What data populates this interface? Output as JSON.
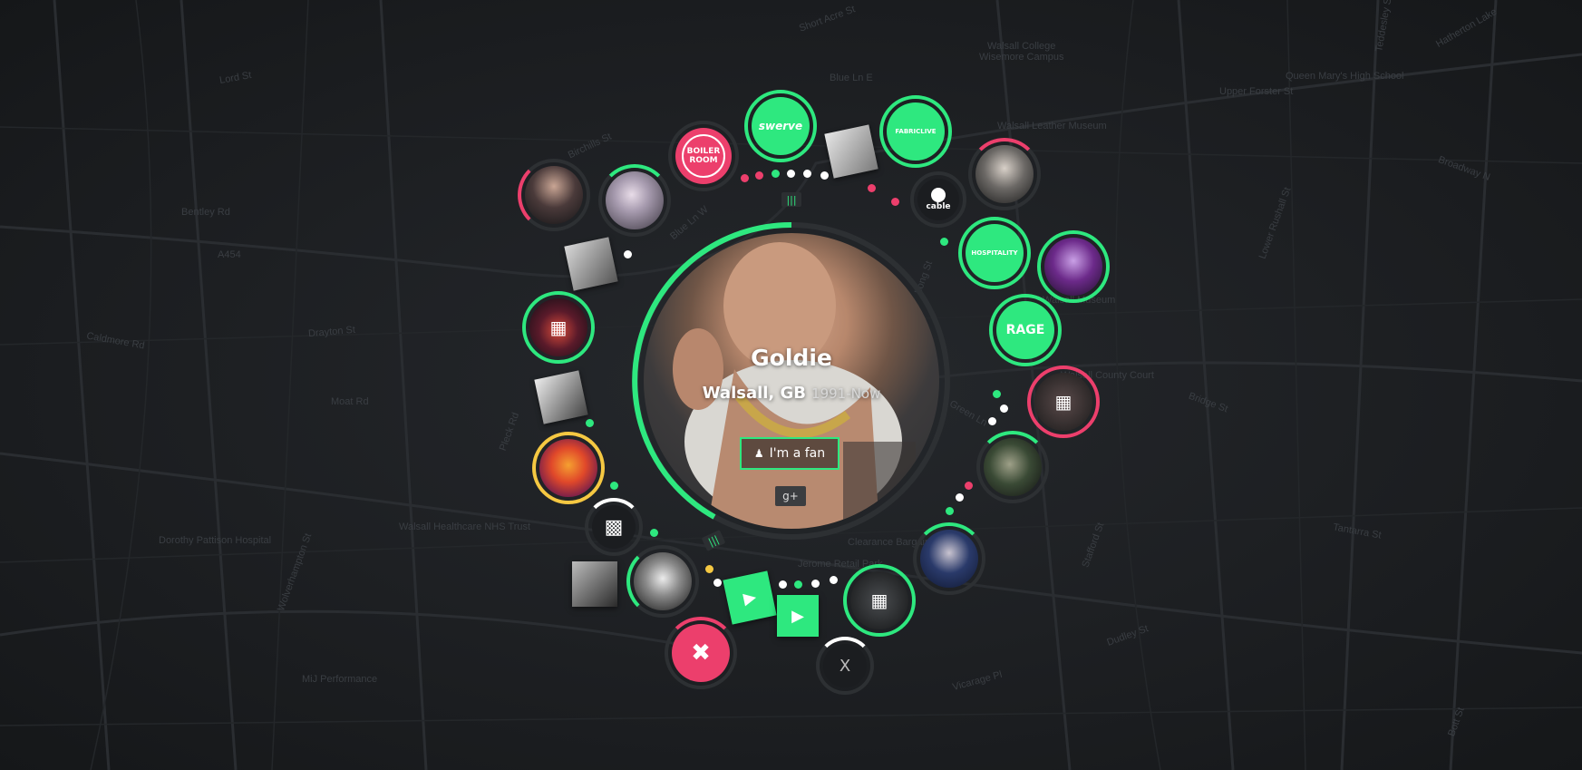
{
  "artist": {
    "name": "Goldie",
    "location": "Walsall, GB",
    "years": "1991-Now",
    "fan_button": "I'm a fan",
    "gplus": "g+"
  },
  "map_labels": [
    "A454",
    "Walsall College",
    "Wisemore Campus",
    "Queen Mary's High School",
    "Walsall Leather Museum",
    "Walsall Museum",
    "Walsall County Court",
    "Walsall Healthcare NHS Trust",
    "MiJ Performance",
    "Blue Ln E",
    "Blue Ln W",
    "Short Acre St",
    "Hatherton Lake",
    "Upper Forster St",
    "Broadway N",
    "Dudley St",
    "Vicarage Pl",
    "Clearance Bargains",
    "Jerome Retail Park",
    "Lower Rushall St",
    "Birchills St",
    "Drayton St",
    "Moat Rd",
    "Pleck Rd",
    "Wolverhampton St",
    "Caldmore Rd",
    "Dorothy Pattison Hospital",
    "Bentley Rd",
    "Lord St",
    "Bridge St",
    "Tantarra St",
    "Teddesley St",
    "Stafford St",
    "Bott St",
    "Long St",
    "Green Ln"
  ],
  "nodes": [
    {
      "label": "BOILER ROOM",
      "kind": "logo"
    },
    {
      "label": "swerve",
      "kind": "logo"
    },
    {
      "label": "FABRICLIVE",
      "kind": "logo"
    },
    {
      "label": "cable",
      "kind": "logo"
    },
    {
      "label": "HOSPITALITY",
      "kind": "logo"
    },
    {
      "label": "RAGE",
      "kind": "logo"
    },
    {
      "label": "calendar-icon",
      "kind": "event"
    },
    {
      "label": "play-icon",
      "kind": "video"
    }
  ],
  "colors": {
    "green": "#2ee87f",
    "pink": "#ec3f6c",
    "yellow": "#f5c842",
    "ring": "#2d3033"
  }
}
